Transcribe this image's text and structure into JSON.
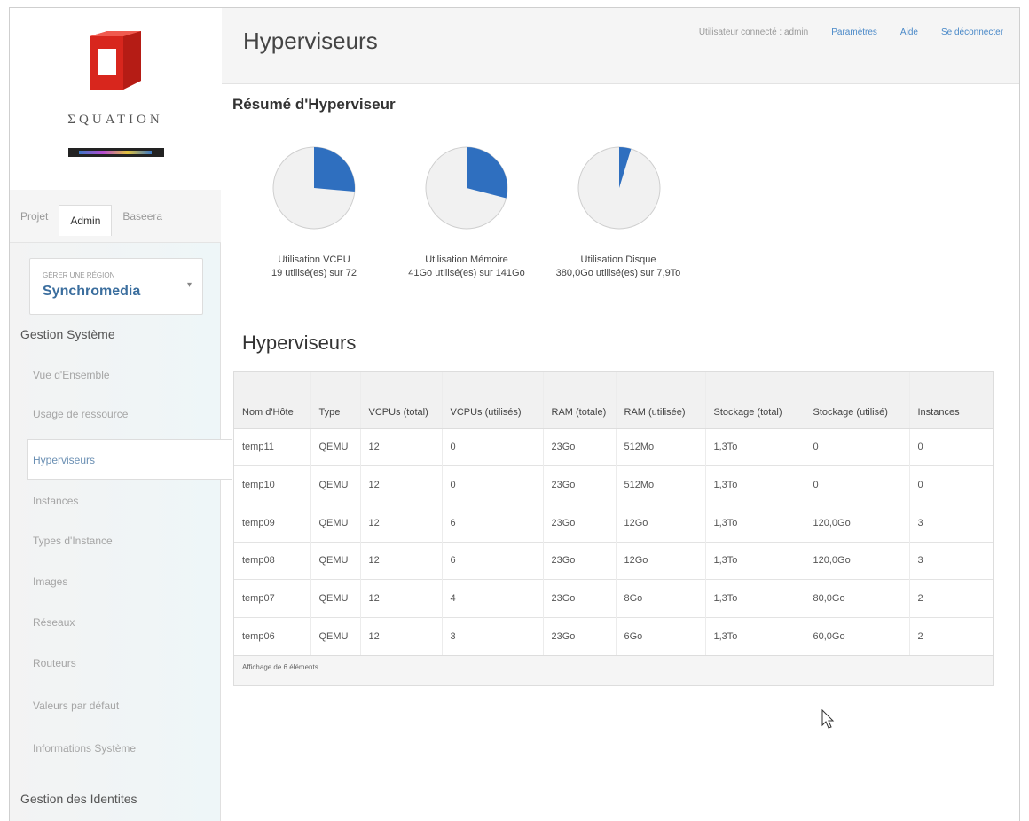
{
  "brand": {
    "name": "ΣQUATION"
  },
  "sidebar": {
    "tabs": [
      {
        "label": "Projet"
      },
      {
        "label": "Admin"
      },
      {
        "label": "Baseera"
      }
    ],
    "region": {
      "label": "GÉRER UNE RÉGION",
      "value": "Synchromedia"
    },
    "sections": [
      {
        "label": "Gestion Système"
      },
      {
        "label": "Gestion des Identites"
      }
    ],
    "items": [
      {
        "label": "Vue d'Ensemble"
      },
      {
        "label": "Usage de ressource"
      },
      {
        "label": "Hyperviseurs"
      },
      {
        "label": "Instances"
      },
      {
        "label": "Types d'Instance"
      },
      {
        "label": "Images"
      },
      {
        "label": "Réseaux"
      },
      {
        "label": "Routeurs"
      },
      {
        "label": "Valeurs par défaut"
      },
      {
        "label": "Informations Système"
      }
    ]
  },
  "header": {
    "title": "Hyperviseurs",
    "user_text": "Utilisateur connecté : admin",
    "links": [
      {
        "label": "Paramètres"
      },
      {
        "label": "Aide"
      },
      {
        "label": "Se déconnecter"
      }
    ]
  },
  "summary": {
    "title": "Résumé d'Hyperviseur",
    "pies": [
      {
        "label": "Utilisation VCPU",
        "detail": "19 utilisé(es) sur 72",
        "fraction": 0.264
      },
      {
        "label": "Utilisation Mémoire",
        "detail": "41Go utilisé(es) sur 141Go",
        "fraction": 0.29
      },
      {
        "label": "Utilisation Disque",
        "detail": "380,0Go utilisé(es) sur 7,9To",
        "fraction": 0.047
      }
    ],
    "colors": {
      "used": "#2f6fbf",
      "free": "#f1f1f1",
      "border": "#cfcfcf"
    }
  },
  "table": {
    "title": "Hyperviseurs",
    "headers": [
      "Nom d'Hôte",
      "Type",
      "VCPUs (total)",
      "VCPUs (utilisés)",
      "RAM (totale)",
      "RAM (utilisée)",
      "Stockage (total)",
      "Stockage (utilisé)",
      "Instances"
    ],
    "rows": [
      [
        "temp11",
        "QEMU",
        "12",
        "0",
        "23Go",
        "512Mo",
        "1,3To",
        "0",
        "0"
      ],
      [
        "temp10",
        "QEMU",
        "12",
        "0",
        "23Go",
        "512Mo",
        "1,3To",
        "0",
        "0"
      ],
      [
        "temp09",
        "QEMU",
        "12",
        "6",
        "23Go",
        "12Go",
        "1,3To",
        "120,0Go",
        "3"
      ],
      [
        "temp08",
        "QEMU",
        "12",
        "6",
        "23Go",
        "12Go",
        "1,3To",
        "120,0Go",
        "3"
      ],
      [
        "temp07",
        "QEMU",
        "12",
        "4",
        "23Go",
        "8Go",
        "1,3To",
        "80,0Go",
        "2"
      ],
      [
        "temp06",
        "QEMU",
        "12",
        "3",
        "23Go",
        "6Go",
        "1,3To",
        "60,0Go",
        "2"
      ]
    ],
    "footer": "Affichage de 6 éléments"
  }
}
